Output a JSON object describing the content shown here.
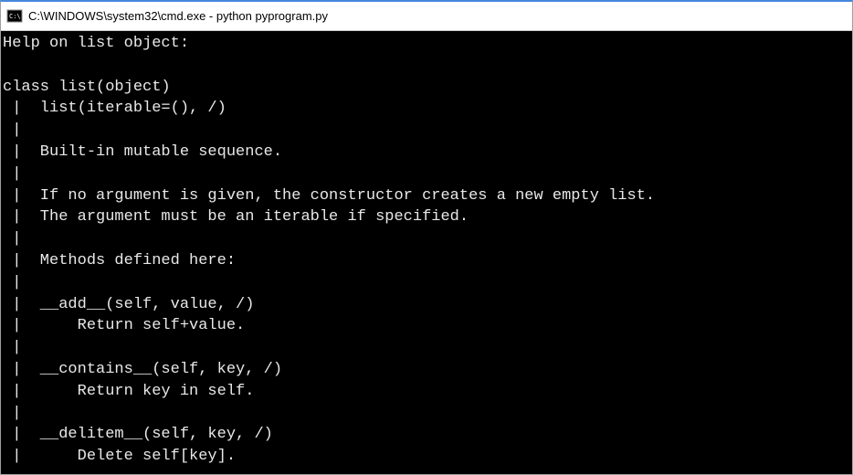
{
  "titlebar": {
    "title": "C:\\WINDOWS\\system32\\cmd.exe - python  pyprogram.py"
  },
  "terminal": {
    "lines": [
      "Help on list object:",
      "",
      "class list(object)",
      " |  list(iterable=(), /)",
      " |",
      " |  Built-in mutable sequence.",
      " |",
      " |  If no argument is given, the constructor creates a new empty list.",
      " |  The argument must be an iterable if specified.",
      " |",
      " |  Methods defined here:",
      " |",
      " |  __add__(self, value, /)",
      " |      Return self+value.",
      " |",
      " |  __contains__(self, key, /)",
      " |      Return key in self.",
      " |",
      " |  __delitem__(self, key, /)",
      " |      Delete self[key]."
    ]
  }
}
